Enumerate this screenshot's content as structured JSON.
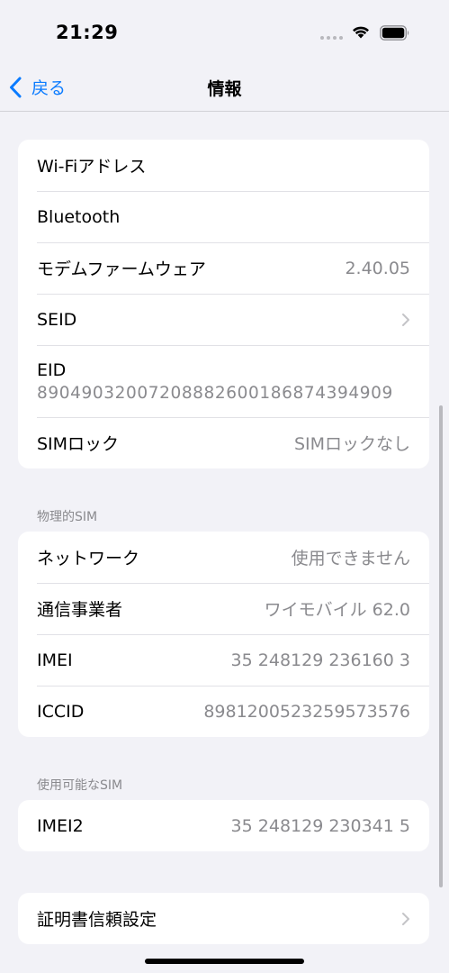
{
  "status_bar": {
    "time": "21:29"
  },
  "nav": {
    "back_label": "戻る",
    "title": "情報"
  },
  "group1": {
    "wifi_address_label": "Wi-Fiアドレス",
    "bluetooth_label": "Bluetooth",
    "modem_firmware_label": "モデムファームウェア",
    "modem_firmware_value": "2.40.05",
    "seid_label": "SEID",
    "eid_label": "EID",
    "eid_value": "89049032007208882600186874394909",
    "sim_lock_label": "SIMロック",
    "sim_lock_value": "SIMロックなし"
  },
  "physical_sim": {
    "header": "物理的SIM",
    "network_label": "ネットワーク",
    "network_value": "使用できません",
    "carrier_label": "通信事業者",
    "carrier_value": "ワイモバイル 62.0",
    "imei_label": "IMEI",
    "imei_value": "35 248129 236160 3",
    "iccid_label": "ICCID",
    "iccid_value": "8981200523259573576"
  },
  "available_sim": {
    "header": "使用可能なSIM",
    "imei2_label": "IMEI2",
    "imei2_value": "35 248129 230341 5"
  },
  "group4": {
    "cert_trust_label": "証明書信頼設定"
  },
  "colors": {
    "accent": "#0a7bff",
    "background": "#f2f2f7",
    "secondary_text": "#8a8a8e"
  }
}
